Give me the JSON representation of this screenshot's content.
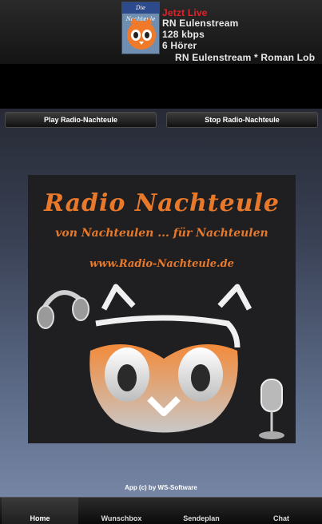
{
  "header": {
    "logo_text": "Die Nachteule",
    "live_label": "Jetzt Live",
    "station": "RN Eulenstream",
    "bitrate": "128 kbps",
    "listeners": "6 Hörer",
    "now_playing": "RN Eulenstream * Roman Lob"
  },
  "controls": {
    "play_label": "Play Radio-Nachteule",
    "stop_label": "Stop Radio-Nachteule"
  },
  "banner": {
    "title": "Radio Nachteule",
    "slogan": "von Nachteulen ... für Nachteulen",
    "url": "www.Radio-Nachteule.de"
  },
  "footer": {
    "credit": "App (c) by WS-Software"
  },
  "tabs": [
    {
      "label": "Home",
      "active": true
    },
    {
      "label": "Wunschbox",
      "active": false
    },
    {
      "label": "Sendeplan",
      "active": false
    },
    {
      "label": "Chat",
      "active": false
    }
  ],
  "colors": {
    "accent_orange": "#e8792a",
    "live_red": "#e2222a"
  }
}
